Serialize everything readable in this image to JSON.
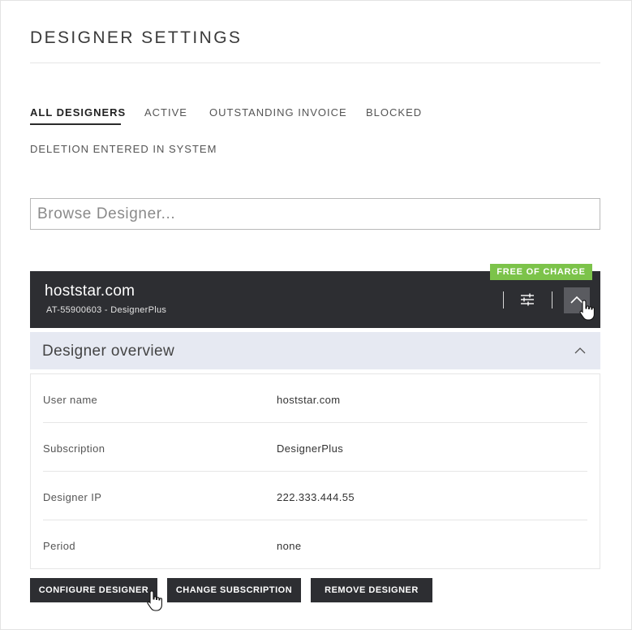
{
  "page": {
    "title": "DESIGNER SETTINGS"
  },
  "tabs": [
    {
      "label": "ALL DESIGNERS",
      "active": true
    },
    {
      "label": "ACTIVE",
      "active": false
    },
    {
      "label": "OUTSTANDING INVOICE",
      "active": false
    },
    {
      "label": "BLOCKED",
      "active": false
    },
    {
      "label": "DELETION ENTERED IN SYSTEM",
      "active": false
    }
  ],
  "search": {
    "placeholder": "Browse Designer...",
    "value": ""
  },
  "designer": {
    "name": "hoststar.com",
    "subtitle": "AT-55900603 - DesignerPlus",
    "badge": "FREE OF CHARGE",
    "settings_icon": "sliders-icon",
    "collapse_icon": "chevron-up-icon"
  },
  "overview": {
    "title": "Designer overview",
    "toggle_icon": "chevron-up-icon",
    "rows": [
      {
        "label": "User name",
        "value": "hoststar.com"
      },
      {
        "label": "Subscription",
        "value": "DesignerPlus"
      },
      {
        "label": "Designer IP",
        "value": "222.333.444.55"
      },
      {
        "label": "Period",
        "value": "none"
      }
    ]
  },
  "actions": {
    "configure": "CONFIGURE DESIGNER",
    "change": "CHANGE SUBSCRIPTION",
    "remove": "REMOVE DESIGNER"
  },
  "colors": {
    "bar": "#2d2e32",
    "badge": "#7cc34a",
    "overview_header": "#e6e9f2"
  }
}
